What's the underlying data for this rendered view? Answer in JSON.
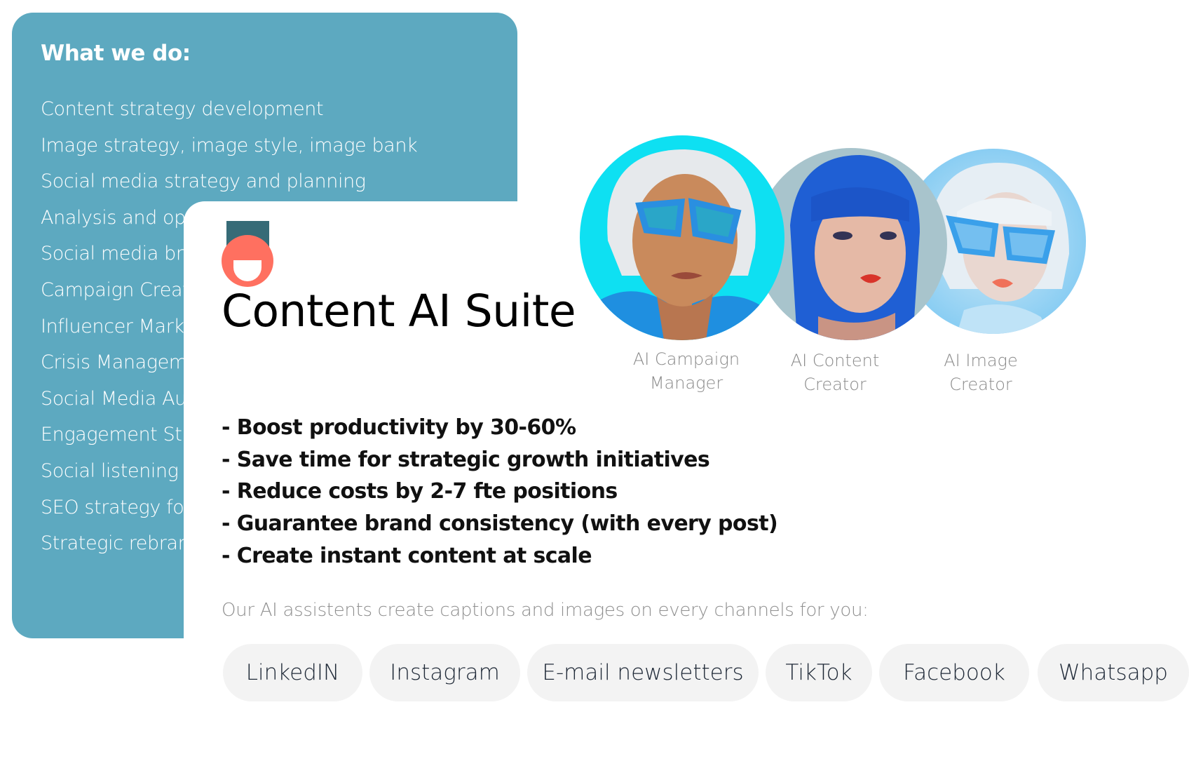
{
  "services": {
    "heading": "What we do:",
    "items": [
      "Content strategy development",
      "Image strategy, image style, image bank",
      "Social media strategy and planning",
      "Analysis and optimization",
      "Social media branding",
      "Campaign Creation",
      "Influencer Marketing",
      "Crisis Management",
      "Social Media Audit",
      "Engagement Strategy",
      "Social listening",
      "SEO strategy for social",
      "Strategic rebranding"
    ]
  },
  "product": {
    "title": "Content AI Suite",
    "logo_colors": {
      "bar": "#366b77",
      "ball": "#ff7060"
    },
    "assistants": [
      {
        "line1": "AI Campaign",
        "line2": "Manager"
      },
      {
        "line1": "AI Content",
        "line2": "Creator"
      },
      {
        "line1": "AI Image",
        "line2": "Creator"
      }
    ],
    "benefits": [
      "- Boost productivity by 30-60%",
      "- Save time for strategic growth initiatives",
      "- Reduce costs by 2-7 fte positions",
      "- Guarantee brand consistency (with every post)",
      "- Create instant content at scale"
    ],
    "channels_intro": "Our AI assistents create captions and images on every channels for you:",
    "channels": [
      "LinkedIN",
      "Instagram",
      "E-mail newsletters",
      "TikTok",
      "Facebook",
      "Whatsapp"
    ]
  },
  "colors": {
    "panel": "#5da9c0",
    "pill": "#f3f3f3"
  }
}
